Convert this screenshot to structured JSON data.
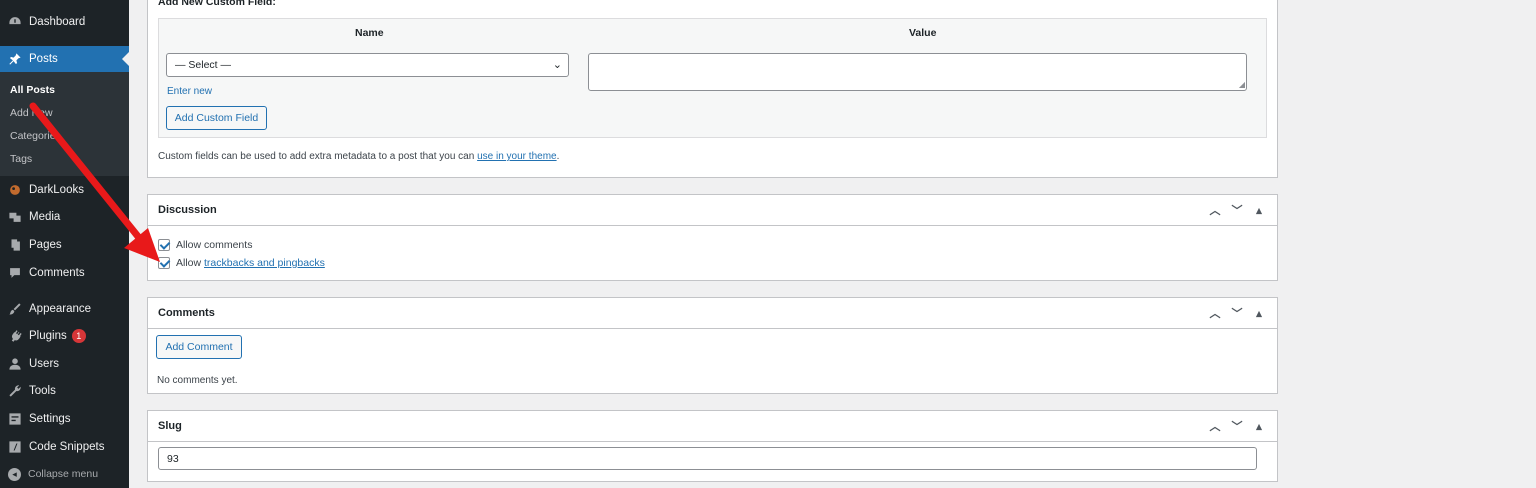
{
  "sidebar": {
    "items": [
      {
        "label": "Dashboard",
        "icon": "dashboard-icon"
      },
      {
        "label": "Posts",
        "icon": "pin-icon"
      },
      {
        "label": "DarkLooks",
        "icon": "darklooks-icon"
      },
      {
        "label": "Media",
        "icon": "media-icon"
      },
      {
        "label": "Pages",
        "icon": "pages-icon"
      },
      {
        "label": "Comments",
        "icon": "comments-icon"
      },
      {
        "label": "Appearance",
        "icon": "paintbrush-icon"
      },
      {
        "label": "Plugins",
        "icon": "plugin-icon",
        "badge": "1"
      },
      {
        "label": "Users",
        "icon": "user-icon"
      },
      {
        "label": "Tools",
        "icon": "wrench-icon"
      },
      {
        "label": "Settings",
        "icon": "settings-icon"
      },
      {
        "label": "Code Snippets",
        "icon": "code-icon"
      }
    ],
    "submenu": [
      "All Posts",
      "Add New",
      "Categories",
      "Tags"
    ],
    "collapse_label": "Collapse menu"
  },
  "custom_fields": {
    "heading": "Add New Custom Field:",
    "col_name": "Name",
    "col_value": "Value",
    "select_value": "— Select —",
    "enter_new": "Enter new",
    "add_button": "Add Custom Field",
    "note_before": "Custom fields can be used to add extra metadata to a post that you can ",
    "note_link": "use in your theme",
    "note_after": "."
  },
  "discussion": {
    "title": "Discussion",
    "allow_comments": "Allow comments",
    "allow_prefix": "Allow ",
    "trackbacks_link": "trackbacks and pingbacks",
    "allow_comments_checked": true,
    "allow_trackbacks_checked": true
  },
  "comments": {
    "title": "Comments",
    "add_button": "Add Comment",
    "empty_text": "No comments yet."
  },
  "slug": {
    "title": "Slug",
    "value": "93"
  },
  "annotation": {
    "arrow_color": "#e8191a"
  },
  "colors": {
    "sidebar_bg": "#1d2327",
    "active": "#2271b1",
    "badge": "#d63638"
  }
}
